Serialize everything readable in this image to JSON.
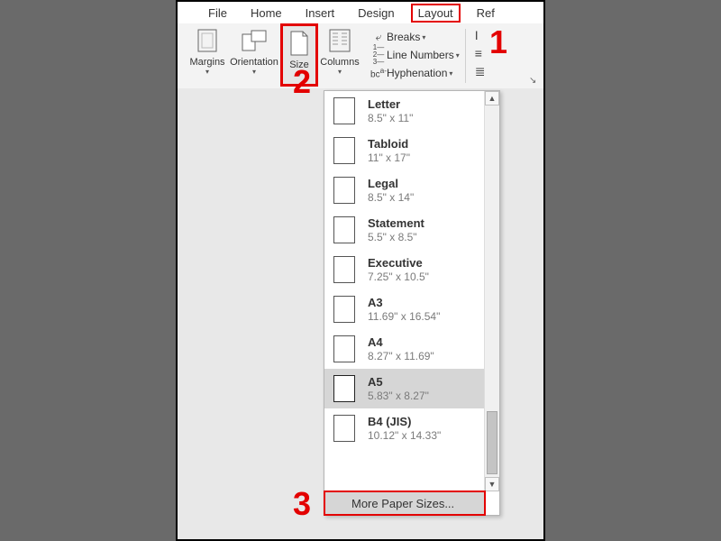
{
  "menu": {
    "file": "File",
    "home": "Home",
    "insert": "Insert",
    "design": "Design",
    "layout": "Layout",
    "references": "Ref"
  },
  "ribbon": {
    "margins": "Margins",
    "orientation": "Orientation",
    "size": "Size",
    "columns": "Columns",
    "breaks": "Breaks",
    "lineNumbers": "Line Numbers",
    "hyphenation": "Hyphenation"
  },
  "sizes": [
    {
      "name": "Letter",
      "dim": "8.5\" x 11\"",
      "selected": false
    },
    {
      "name": "Tabloid",
      "dim": "11\" x 17\"",
      "selected": false
    },
    {
      "name": "Legal",
      "dim": "8.5\" x 14\"",
      "selected": false
    },
    {
      "name": "Statement",
      "dim": "5.5\" x 8.5\"",
      "selected": false
    },
    {
      "name": "Executive",
      "dim": "7.25\" x 10.5\"",
      "selected": false
    },
    {
      "name": "A3",
      "dim": "11.69\" x 16.54\"",
      "selected": false
    },
    {
      "name": "A4",
      "dim": "8.27\" x 11.69\"",
      "selected": false
    },
    {
      "name": "A5",
      "dim": "5.83\" x 8.27\"",
      "selected": true
    },
    {
      "name": "B4 (JIS)",
      "dim": "10.12\" x 14.33\"",
      "selected": false
    }
  ],
  "more_sizes": "More Paper Sizes...",
  "annotations": {
    "a1": "1",
    "a2": "2",
    "a3": "3"
  }
}
